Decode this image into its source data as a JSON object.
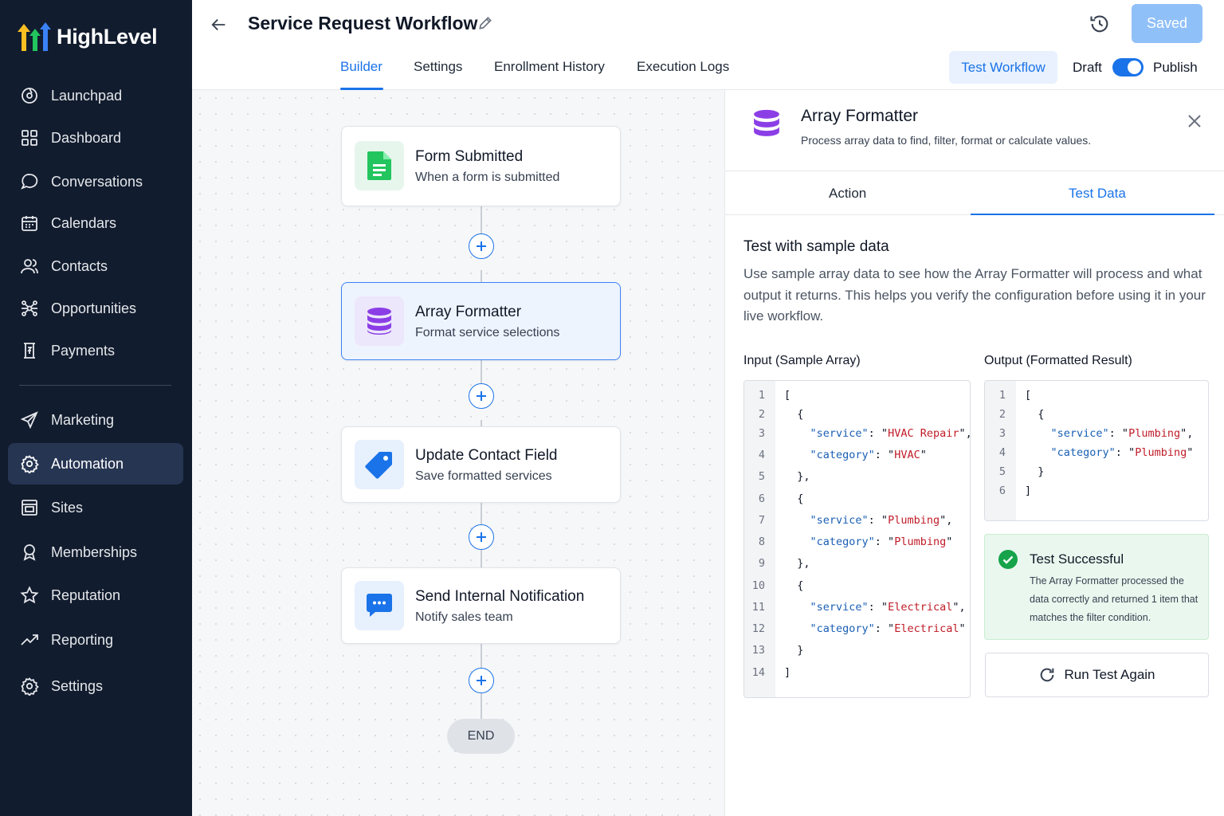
{
  "app": {
    "name": "HighLevel"
  },
  "sidebar": {
    "items": [
      {
        "label": "Launchpad",
        "icon": "rocket-icon"
      },
      {
        "label": "Dashboard",
        "icon": "grid-icon"
      },
      {
        "label": "Conversations",
        "icon": "chat-bubble-icon"
      },
      {
        "label": "Calendars",
        "icon": "calendar-icon"
      },
      {
        "label": "Contacts",
        "icon": "users-icon"
      },
      {
        "label": "Opportunities",
        "icon": "network-icon"
      },
      {
        "label": "Payments",
        "icon": "receipt-icon"
      },
      {
        "label": "Marketing",
        "icon": "send-icon"
      },
      {
        "label": "Automation",
        "icon": "gear-icon",
        "active": true
      },
      {
        "label": "Sites",
        "icon": "website-icon"
      },
      {
        "label": "Memberships",
        "icon": "badge-icon"
      },
      {
        "label": "Reputation",
        "icon": "star-icon"
      },
      {
        "label": "Reporting",
        "icon": "trend-icon"
      },
      {
        "label": "Settings",
        "icon": "settings-icon"
      }
    ]
  },
  "header": {
    "title": "Service Request Workflow",
    "saved_label": "Saved",
    "tabs": [
      {
        "label": "Builder",
        "active": true
      },
      {
        "label": "Settings"
      },
      {
        "label": "Enrollment History"
      },
      {
        "label": "Execution Logs"
      }
    ],
    "test_workflow_label": "Test Workflow",
    "draft_label": "Draft",
    "publish_label": "Publish",
    "publish_toggle_on": true
  },
  "workflow": {
    "nodes": [
      {
        "title": "Form Submitted",
        "subtitle": "When a form is submitted",
        "icon": "form-icon"
      },
      {
        "title": "Array Formatter",
        "subtitle": "Format service selections",
        "icon": "database-icon",
        "selected": true
      },
      {
        "title": "Update Contact Field",
        "subtitle": "Save formatted services",
        "icon": "tag-icon"
      },
      {
        "title": "Send Internal Notification",
        "subtitle": "Notify sales team",
        "icon": "message-icon"
      }
    ],
    "end_label": "END"
  },
  "panel": {
    "title": "Array Formatter",
    "description": "Process array data to find, filter, format or calculate values.",
    "tabs": [
      {
        "label": "Action"
      },
      {
        "label": "Test Data",
        "active": true
      }
    ],
    "section_title": "Test with sample data",
    "section_description": "Use sample array data to see how the Array Formatter will process and what output it returns. This helps you verify the configuration before using it in your live workflow.",
    "input_label": "Input (Sample Array)",
    "output_label": "Output (Formatted Result)",
    "input_lines": [
      "1",
      "2",
      "3",
      "4",
      "5",
      "6",
      "7",
      "8",
      "9",
      "10",
      "11",
      "12",
      "13",
      "14"
    ],
    "input_items": [
      {
        "service": "HVAC Repair",
        "category": "HVAC"
      },
      {
        "service": "Plumbing",
        "category": "Plumbing"
      },
      {
        "service": "Electrical",
        "category": "Electrical"
      }
    ],
    "output_lines": [
      "1",
      "2",
      "3",
      "4",
      "5",
      "6"
    ],
    "output_items": [
      {
        "service": "Plumbing",
        "category": "Plumbing"
      }
    ],
    "keys": {
      "service": "\"service\"",
      "category": "\"category\""
    },
    "success_title": "Test Successful",
    "success_message": "The Array Formatter processed the data correctly and returned 1 item that matches the filter condition.",
    "run_again_label": "Run Test Again"
  },
  "colors": {
    "accent": "#1a73e8",
    "sidebar_bg": "#111c2e",
    "sidebar_active": "#263552",
    "success_bg": "#eaf7ee",
    "success_icon": "#16a34a",
    "string_red": "#c01c28",
    "key_blue": "#1a5fb4"
  }
}
